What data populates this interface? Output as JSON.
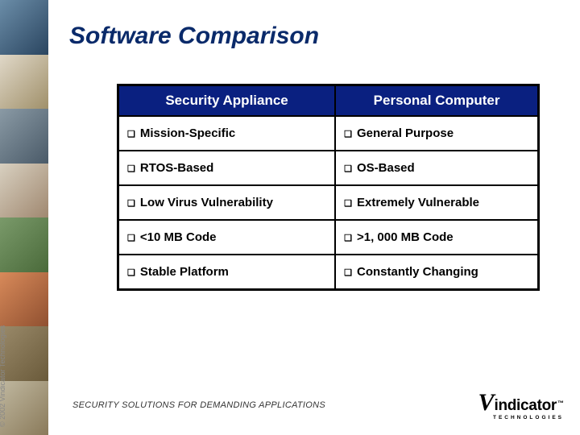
{
  "title": "Software Comparison",
  "table": {
    "headers": [
      "Security Appliance",
      "Personal Computer"
    ],
    "rows": [
      [
        "Mission-Specific",
        "General Purpose"
      ],
      [
        "RTOS-Based",
        "OS-Based"
      ],
      [
        "Low Virus Vulnerability",
        "Extremely Vulnerable"
      ],
      [
        "<10 MB Code",
        ">1, 000 MB Code"
      ],
      [
        "Stable Platform",
        "Constantly Changing"
      ]
    ]
  },
  "footer": {
    "tagline": "SECURITY SOLUTIONS FOR DEMANDING APPLICATIONS",
    "logo_main": "indicator",
    "logo_v": "V",
    "logo_sub": "TECHNOLOGIES"
  },
  "copyright": "© 2002 Vindicator Technologies"
}
